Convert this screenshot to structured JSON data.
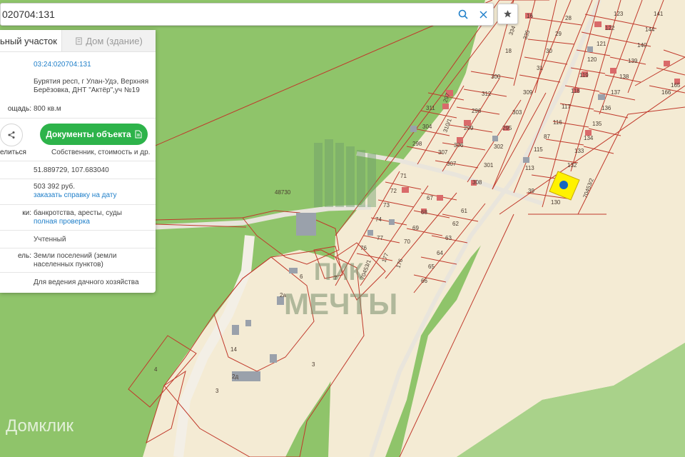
{
  "search": {
    "value": "020704:131"
  },
  "tabs": {
    "parcel": "ьный участок",
    "building": "Дом (здание)"
  },
  "panel": {
    "cadastral_number": "03:24:020704:131",
    "address": "Бурятия респ, г Улан-Удэ, Верхняя Берёзовка, ДНТ \"Актёр\",уч №19",
    "area_label": "ощадь:",
    "area_value": "800 кв.м",
    "share_label": "елиться",
    "docs_button": "Документы объекта",
    "docs_subtitle": "Собственник, стоимость и др.",
    "coordinates": "51.889729, 107.683040",
    "price": "503 392 руб.",
    "order_link": "заказать справку на дату",
    "checks_label": "ки:",
    "checks_value": "банкротства, аресты, суды",
    "full_check_link": "полная проверка",
    "status": "Учтенный",
    "category_label": "ель:",
    "category_value": "Земли поселений (земли населенных пунктов)",
    "use_value": "Для ведения дачного хозяйства"
  },
  "map": {
    "labels": {
      "l28": "28",
      "l29": "29",
      "l30": "30",
      "l31": "31",
      "l18": "18",
      "l334": "334",
      "l335": "335",
      "l16": "16",
      "l123": "123",
      "l122": "122",
      "l121": "121",
      "l120": "120",
      "l119": "119",
      "l118": "118",
      "l117": "117",
      "l116": "116",
      "l141": "141",
      "l144": "144",
      "l140": "140",
      "l139": "139",
      "l138": "138",
      "l137": "137",
      "l136": "136",
      "l135": "135",
      "l134": "134",
      "l133": "133",
      "l132": "132",
      "l166": "166",
      "l165": "165",
      "l300": "300",
      "l312": "312",
      "l309": "309",
      "l311": "311",
      "l297": "297",
      "l296": "296",
      "l303": "303",
      "l304": "304",
      "l310": "310/1",
      "l299": "299",
      "l295": "295",
      "l298": "298",
      "l306": "306",
      "l302": "302",
      "l307a": "307",
      "l307b": "307",
      "l301": "301",
      "l308": "308",
      "l87": "87",
      "l115": "115",
      "l113": "113",
      "l39": "39",
      "l130": "130",
      "l70453_2": "70453/2",
      "l71": "71",
      "l72": "72",
      "l67": "67",
      "l73": "73",
      "l68": "68",
      "l61": "61",
      "l74": "74",
      "l69": "69",
      "l62": "62",
      "l77": "77",
      "l70": "70",
      "l63": "63",
      "l76": "76",
      "l177": "177",
      "l176": "176",
      "l64": "64",
      "l65": "65",
      "l66": "66",
      "l70453_1": "70453/1",
      "l48730": "48730",
      "l6": "6",
      "l7": "7",
      "l2a": "2а",
      "l14": "14",
      "l3a": "3",
      "l3b": "3",
      "l2d": "2д",
      "l4": "4"
    },
    "watermark_brand": "Домклик",
    "watermark_text_1": "ПИК",
    "watermark_text_2": "МЕЧТЫ",
    "selected_color": "#fff200",
    "boundary_color": "#c0392b",
    "land_color": "#f4ebd4",
    "forest_color": "#8fc46a"
  }
}
